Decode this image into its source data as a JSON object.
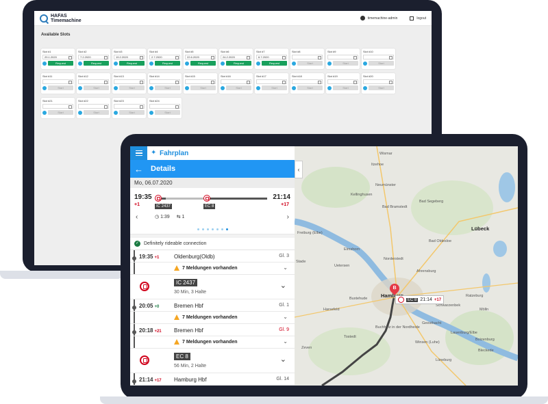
{
  "admin": {
    "brand_line1": "HAFAS",
    "brand_line2": "Timemachine",
    "user": "timemachine-admin",
    "logout": "logout",
    "section_title": "Available Slots",
    "slots": [
      {
        "name": "Slot #1",
        "date": "29.1.2020",
        "action": "Request",
        "active": true
      },
      {
        "name": "Slot #2",
        "date": "7.2.2020",
        "action": "Request",
        "active": true
      },
      {
        "name": "Slot #3",
        "date": "19.2.2020",
        "action": "Request",
        "active": true
      },
      {
        "name": "Slot #4",
        "date": "2.7.2020",
        "action": "Request",
        "active": true
      },
      {
        "name": "Slot #5",
        "date": "22.6.2020",
        "action": "Request",
        "active": true
      },
      {
        "name": "Slot #6",
        "date": "24.2.2020",
        "action": "Request",
        "active": true
      },
      {
        "name": "Slot #7",
        "date": "6.7.2020",
        "action": "Request",
        "active": true
      },
      {
        "name": "Slot #8",
        "date": "",
        "action": "Start",
        "active": false
      },
      {
        "name": "Slot #9",
        "date": "",
        "action": "Start",
        "active": false
      },
      {
        "name": "Slot #10",
        "date": "",
        "action": "Start",
        "active": false
      },
      {
        "name": "Slot #11",
        "date": "",
        "action": "Start",
        "active": false
      },
      {
        "name": "Slot #12",
        "date": "",
        "action": "Start",
        "active": false
      },
      {
        "name": "Slot #13",
        "date": "",
        "action": "Start",
        "active": false
      },
      {
        "name": "Slot #14",
        "date": "",
        "action": "Start",
        "active": false
      },
      {
        "name": "Slot #15",
        "date": "",
        "action": "Start",
        "active": false
      },
      {
        "name": "Slot #16",
        "date": "",
        "action": "Start",
        "active": false
      },
      {
        "name": "Slot #17",
        "date": "",
        "action": "Start",
        "active": false
      },
      {
        "name": "Slot #18",
        "date": "",
        "action": "Start",
        "active": false
      },
      {
        "name": "Slot #19",
        "date": "",
        "action": "Start",
        "active": false
      },
      {
        "name": "Slot #20",
        "date": "",
        "action": "Start",
        "active": false
      },
      {
        "name": "Slot #21",
        "date": "",
        "action": "Start",
        "active": false
      },
      {
        "name": "Slot #22",
        "date": "",
        "action": "Start",
        "active": false
      },
      {
        "name": "Slot #23",
        "date": "",
        "action": "Start",
        "active": false
      },
      {
        "name": "Slot #24",
        "date": "",
        "action": "Start",
        "active": false
      }
    ]
  },
  "app": {
    "title": "Fahrplan",
    "details_title": "Details",
    "date": "Mo, 06.07.2020",
    "journey": {
      "departure": "19:35",
      "departure_delay": "+1",
      "arrival": "21:14",
      "arrival_delay": "+17",
      "train1": "IC 2437",
      "train2": "EC 8",
      "duration": "1:39",
      "changes": "1"
    },
    "dot_count": 7,
    "active_dot": 6,
    "rideable": "Definitely rideable connection",
    "warning": "7 Meldungen vorhanden",
    "stops": {
      "s1": {
        "time": "19:35",
        "delay": "+1",
        "name": "Oldenburg(Oldb)",
        "gl": "Gl. 3"
      },
      "t1": {
        "train": "IC 2437",
        "info": "30 Min, 3 Halte"
      },
      "s2": {
        "time": "20:05",
        "delay": "+0",
        "name": "Bremen Hbf",
        "gl": "Gl. 1"
      },
      "s3": {
        "time": "20:18",
        "delay": "+21",
        "name": "Bremen Hbf",
        "gl": "Gl. 9"
      },
      "t2": {
        "train": "EC 8",
        "info": "56 Min, 2 Halte"
      },
      "s4": {
        "time": "21:14",
        "delay": "+17",
        "name": "Hamburg Hbf",
        "gl": "Gl. 14"
      }
    }
  },
  "map": {
    "labels": {
      "stade": "Stade",
      "neumunster": "Neumünster",
      "itzehoe": "Itzehoe",
      "kellinghusen": "Kellinghusen",
      "bad_segeberg": "Bad Segeberg",
      "lubeck": "Lübeck",
      "freiburg": "Freiburg (Elbe)",
      "bad_oldesloe": "Bad Oldesloe",
      "elmshorn": "Elmshorn",
      "norderstedt": "Norderstedt",
      "uetersen": "Uetersen",
      "ahrensburg": "Ahrensburg",
      "hamburg": "Hamburg",
      "harsefeld": "Harsefeld",
      "buxtehude": "Buxtehude",
      "schwarzenbek": "Schwarzenbek",
      "ratzeburg": "Ratzeburg",
      "molln": "Mölln",
      "geesthacht": "Geesthacht",
      "lauenburg": "Lauenburg/Elbe",
      "tostedt": "Tostedt",
      "buchholz": "Buchholz in der Nordheide",
      "winsen": "Winsen (Luhe)",
      "boizenburg": "Boizenburg",
      "luneburg": "Lüneburg",
      "zeven": "Zeven",
      "bleckede": "Bleckede",
      "bad_bramstedt": "Bad Bramstedt",
      "wismar": "Wismar"
    },
    "marker_letter": "B",
    "popup_train": "EC 8",
    "popup_time": "21:14",
    "popup_delay": "+17"
  }
}
